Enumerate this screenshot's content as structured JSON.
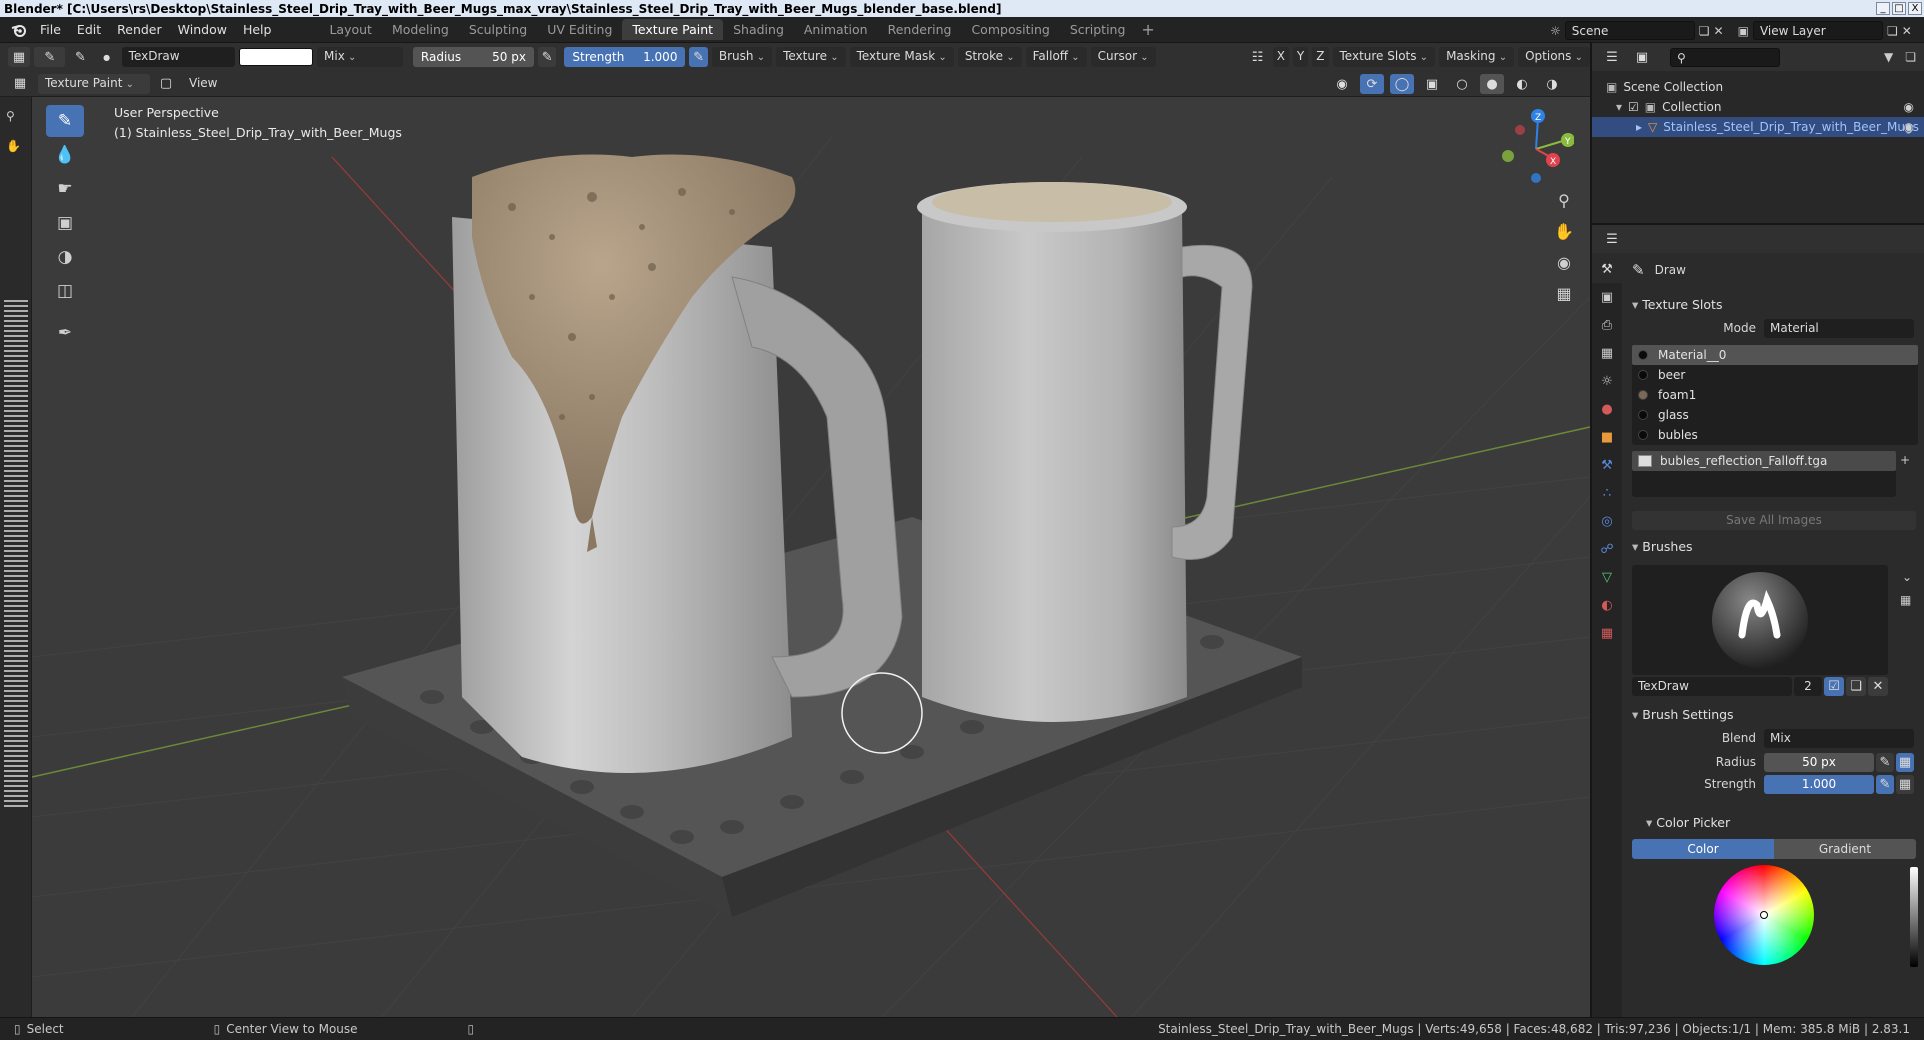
{
  "window": {
    "title": "Blender* [C:\\Users\\rs\\Desktop\\Stainless_Steel_Drip_Tray_with_Beer_Mugs_max_vray\\Stainless_Steel_Drip_Tray_with_Beer_Mugs_blender_base.blend]",
    "min": "_",
    "max": "□",
    "close": "X"
  },
  "menu": [
    "File",
    "Edit",
    "Render",
    "Window",
    "Help"
  ],
  "workspaces": [
    "Layout",
    "Modeling",
    "Sculpting",
    "UV Editing",
    "Texture Paint",
    "Shading",
    "Animation",
    "Rendering",
    "Compositing",
    "Scripting"
  ],
  "active_workspace": "Texture Paint",
  "scene": {
    "scene_name": "Scene",
    "view_layer": "View Layer"
  },
  "tool_header": {
    "brush_name": "TexDraw",
    "blend": "Mix",
    "radius_label": "Radius",
    "radius_value": "50 px",
    "strength_label": "Strength",
    "strength_value": "1.000",
    "menus": [
      "Brush",
      "Texture",
      "Texture Mask",
      "Stroke",
      "Falloff",
      "Cursor"
    ],
    "axes": [
      "X",
      "Y",
      "Z"
    ],
    "right_menus": [
      "Texture Slots",
      "Masking",
      "Options"
    ]
  },
  "mode_header": {
    "mode": "Texture Paint",
    "view": "View"
  },
  "viewport": {
    "perspective": "User Perspective",
    "object": "(1) Stainless_Steel_Drip_Tray_with_Beer_Mugs",
    "gizmo_axes": {
      "x": "X",
      "y": "Y",
      "z": "Z"
    }
  },
  "outliner": {
    "scene_collection": "Scene Collection",
    "collection": "Collection",
    "object": "Stainless_Steel_Drip_Tray_with_Beer_Mugs"
  },
  "properties": {
    "tool_name": "Draw",
    "texture_slots_title": "Texture Slots",
    "mode_label": "Mode",
    "mode_value": "Material",
    "materials": [
      "Material__0",
      "beer",
      "foam1",
      "glass",
      "bubles"
    ],
    "image_slot": "bubles_reflection_Falloff.tga",
    "save_all": "Save All Images",
    "brushes_title": "Brushes",
    "brush_name": "TexDraw",
    "brush_users": "2",
    "brush_settings_title": "Brush Settings",
    "blend_label": "Blend",
    "blend_value": "Mix",
    "radius_label": "Radius",
    "radius_value": "50 px",
    "strength_label": "Strength",
    "strength_value": "1.000",
    "color_picker_title": "Color Picker",
    "color_tab": "Color",
    "gradient_tab": "Gradient"
  },
  "statusbar": {
    "select": "Select",
    "center_view": "Center View to Mouse",
    "stats": "Stainless_Steel_Drip_Tray_with_Beer_Mugs | Verts:49,658 | Faces:48,682 | Tris:97,236 | Objects:1/1 | Mem: 385.8 MiB | 2.83.1"
  },
  "colors": {
    "accent": "#4772b3",
    "selection": "#334d80",
    "viewport_bg": "#3b3b3b",
    "x_axis": "#e0434e",
    "y_axis": "#8bbb3d",
    "z_axis": "#2f83e6"
  }
}
